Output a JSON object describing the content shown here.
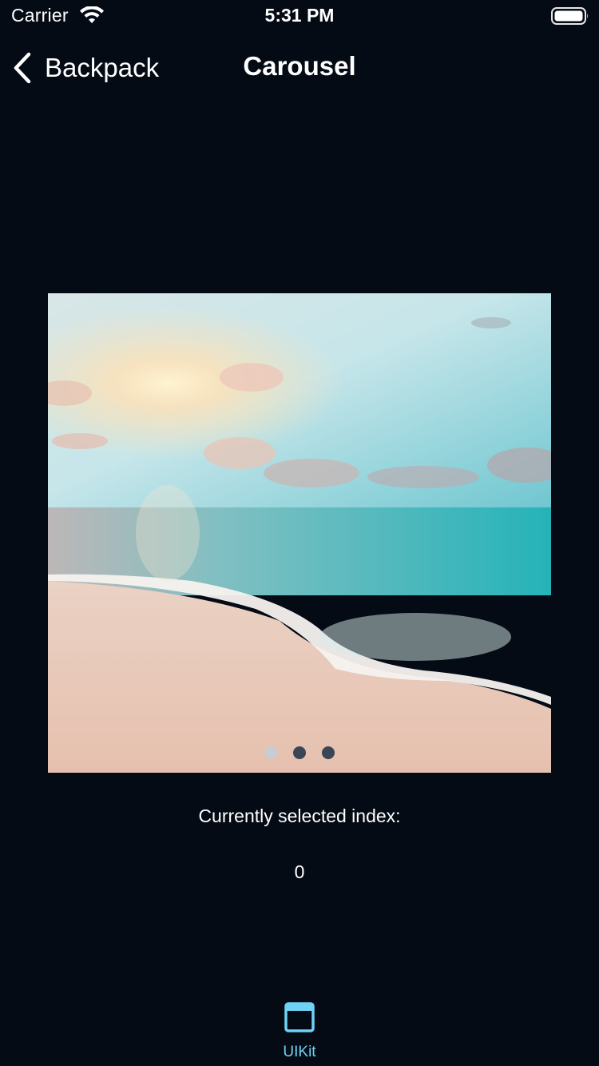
{
  "status_bar": {
    "carrier": "Carrier",
    "time": "5:31 PM",
    "icons": [
      "wifi-icon",
      "battery-icon"
    ]
  },
  "nav_bar": {
    "back_label": "Backpack",
    "title": "Carousel",
    "back_icon": "chevron-left-icon"
  },
  "carousel": {
    "image_subject": "beach at sunset",
    "page_count": 3,
    "current_page": 0
  },
  "selection": {
    "label": "Currently selected index:",
    "value": "0"
  },
  "tab_bar": {
    "items": [
      {
        "label": "UIKit",
        "icon": "window-icon",
        "selected": true
      }
    ]
  },
  "colors": {
    "background": "#050b15",
    "text": "#ffffff",
    "tab_accent": "#6fd2f5",
    "dot_active": "#c8ccd3",
    "dot_inactive": "#3a4556"
  }
}
